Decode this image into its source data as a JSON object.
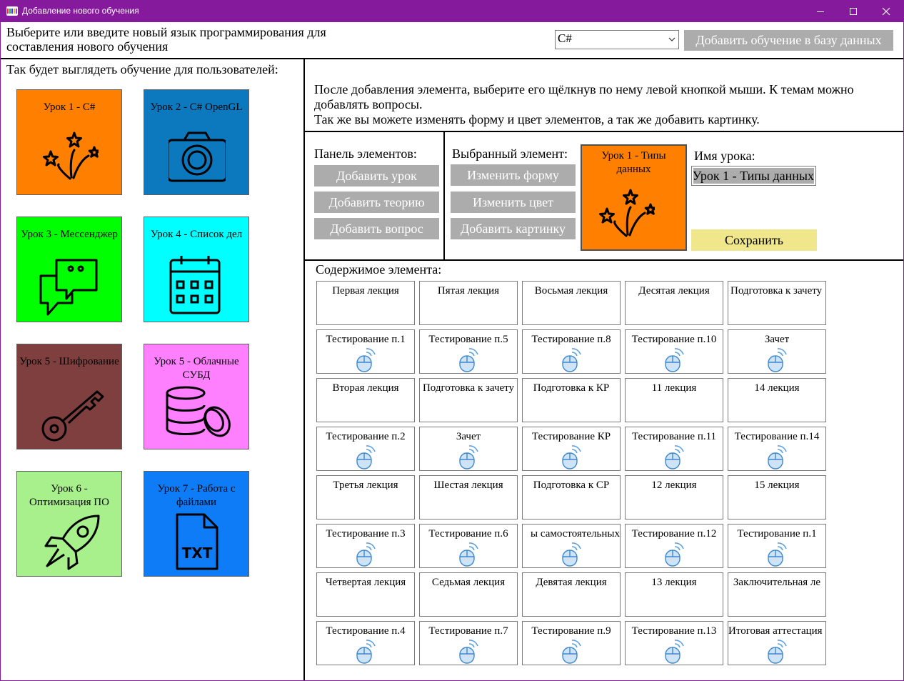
{
  "window": {
    "title": "Добавление нового обучения",
    "title_bar_color": "#861a9d",
    "controls": [
      "minimize-icon",
      "maximize-icon",
      "close-icon"
    ]
  },
  "header": {
    "prompt": "Выберите или введите новый язык программирования для\nсоставления нового обучения",
    "language_value": "C#",
    "add_training_label": "Добавить обучение в базу данных"
  },
  "preview": {
    "caption": "Так будет выглядеть обучение для пользователей:",
    "lessons": [
      {
        "title": "Урок 1 - C#",
        "color": "#ff7f00",
        "icon": "fireworks-icon"
      },
      {
        "title": "Урок 2 - C# OpenGL",
        "color": "#0c78bd",
        "icon": "camera-icon"
      },
      {
        "title": "Урок 3 - Мессенджер",
        "color": "#00ff00",
        "icon": "chat-bubbles-icon"
      },
      {
        "title": "Урок 4 - Список дел",
        "color": "#00ffff",
        "icon": "calendar-icon"
      },
      {
        "title": "Урок 5 - Шифрование",
        "color": "#7f3f3f",
        "icon": "key-icon"
      },
      {
        "title": "Урок 5 - Облачные СУБД",
        "color": "#ff80ff",
        "icon": "database-icon"
      },
      {
        "title": "Урок 6 - Оптимизация ПО",
        "color": "#a7f08b",
        "icon": "rocket-icon"
      },
      {
        "title": "Урок 7 - Работа с файлами",
        "color": "#0e7cf7",
        "icon": "txt-file-icon"
      }
    ]
  },
  "info": {
    "text": "После добавления элемента, выберите его щёлкнув по нему левой кнопкой мыши. К темам можно добавлять вопросы.\nТак же вы можете изменять форму и цвет элементов, а так же добавить картинку."
  },
  "elements_panel": {
    "title": "Панель элементов:",
    "buttons": [
      "Добавить урок",
      "Добавить теорию",
      "Добавить вопрос"
    ]
  },
  "selected": {
    "title": "Выбранный элемент:",
    "buttons": [
      "Изменить форму",
      "Изменить цвет",
      "Добавить картинку"
    ],
    "preview_title": "Урок 1 - Типы данных",
    "preview_color": "#ff7f00",
    "name_label": "Имя урока:",
    "name_value": "Урок 1 - Типы данных",
    "save_label": "Сохранить",
    "save_color": "#f0e68c"
  },
  "content": {
    "caption": "Содержимое элемента:",
    "rows": [
      [
        "Первая лекция",
        "Пятая лекция",
        "Восьмая лекция",
        "Десятая лекция",
        "Подготовка к зачету"
      ],
      [
        "Тестирование п.1",
        "Тестирование п.5",
        "Тестирование п.8",
        "Тестирование п.10",
        "Зачет"
      ],
      [
        "Вторая лекция",
        "Подготовка к зачету",
        "Подготовка к КР",
        "11 лекция",
        "14 лекция"
      ],
      [
        "Тестирование п.2",
        "Зачет",
        "Тестирование КР",
        "Тестирование п.11",
        "Тестирование п.14"
      ],
      [
        "Третья лекция",
        "Шестая лекция",
        "Подготовка к СР",
        "12 лекция",
        "15 лекция"
      ],
      [
        "Тестирование п.3",
        "Тестирование п.6",
        "ы самостоятельных",
        "Тестирование п.12",
        "Тестирование п.1"
      ],
      [
        "Четвертая лекция",
        "Седьмая лекция",
        "Девятая лекция",
        "13 лекция",
        "Заключительная ле"
      ],
      [
        "Тестирование п.4",
        "Тестирование п.7",
        "Тестирование п.9",
        "Тестирование п.13",
        "Итоговая аттестация"
      ]
    ]
  }
}
